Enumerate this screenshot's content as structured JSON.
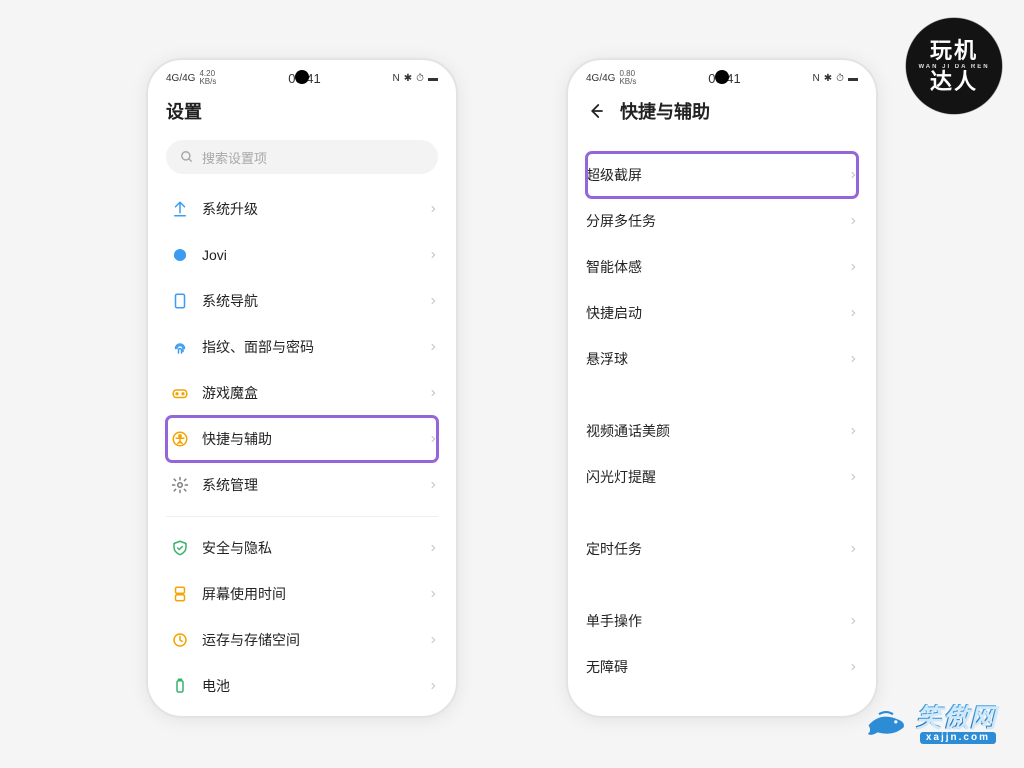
{
  "status": {
    "signal": "4G/4G",
    "speed_top": "4.20",
    "speed_bot": "KB/s",
    "speed2_top": "0.80",
    "speed2_bot": "KB/s",
    "time": "00:41",
    "nfc": "N",
    "bt": "⚲",
    "alarm": "⏰",
    "bat": "▢"
  },
  "phone1": {
    "title": "设置",
    "search_placeholder": "搜索设置项",
    "group1": [
      {
        "icon": "upgrade-icon",
        "color": "#3b9cf1",
        "label": "系统升级"
      },
      {
        "icon": "jovi-icon",
        "color": "#3b9cf1",
        "label": "Jovi"
      },
      {
        "icon": "nav-icon",
        "color": "#3b9cf1",
        "label": "系统导航"
      },
      {
        "icon": "fingerprint-icon",
        "color": "#3b9cf1",
        "label": "指纹、面部与密码"
      },
      {
        "icon": "gamebox-icon",
        "color": "#f4a400",
        "label": "游戏魔盒"
      },
      {
        "icon": "accessibility-icon",
        "color": "#f4a400",
        "label": "快捷与辅助",
        "hl": true
      },
      {
        "icon": "system-mgmt-icon",
        "color": "#7d7d7d",
        "label": "系统管理"
      }
    ],
    "group2": [
      {
        "icon": "security-icon",
        "color": "#37b36b",
        "label": "安全与隐私"
      },
      {
        "icon": "screentime-icon",
        "color": "#f4a400",
        "label": "屏幕使用时间"
      },
      {
        "icon": "storage-icon",
        "color": "#f4a400",
        "label": "运存与存储空间"
      },
      {
        "icon": "battery-icon",
        "color": "#37b36b",
        "label": "电池"
      }
    ]
  },
  "phone2": {
    "title": "快捷与辅助",
    "group1": [
      {
        "label": "超级截屏",
        "hl": true
      },
      {
        "label": "分屏多任务"
      },
      {
        "label": "智能体感"
      },
      {
        "label": "快捷启动"
      },
      {
        "label": "悬浮球"
      }
    ],
    "group2": [
      {
        "label": "视频通话美颜"
      },
      {
        "label": "闪光灯提醒"
      }
    ],
    "group3": [
      {
        "label": "定时任务"
      }
    ],
    "group4": [
      {
        "label": "单手操作"
      },
      {
        "label": "无障碍"
      }
    ]
  },
  "badge": {
    "line1": "玩机",
    "arc": "WAN JI DA REN",
    "line2": "达人"
  },
  "watermark": {
    "cn": "笑傲网",
    "url": "xajjn.com"
  },
  "colors": {
    "highlight": "#9566d9"
  }
}
